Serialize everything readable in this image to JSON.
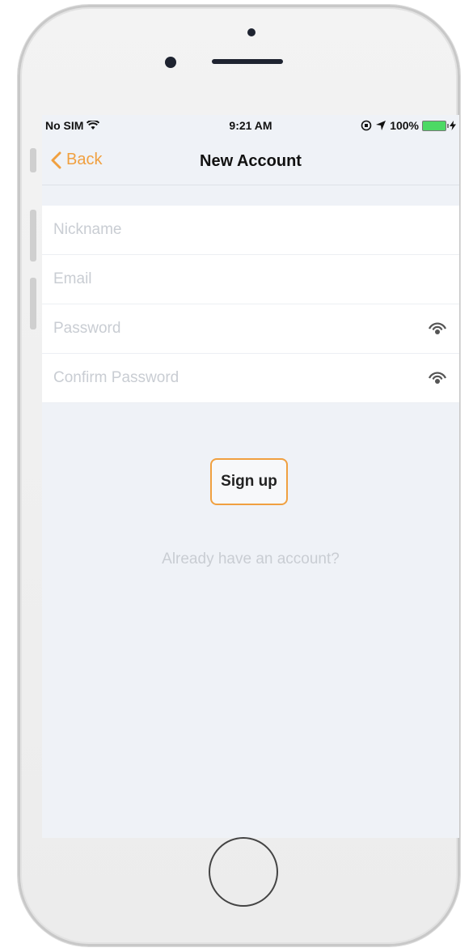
{
  "status_bar": {
    "carrier": "No SIM",
    "time": "9:21 AM",
    "battery": "100%",
    "wifi_icon": "wifi-icon",
    "location_icon": "location-arrow-icon",
    "lock_icon": "orientation-lock-icon"
  },
  "nav": {
    "back_label": "Back",
    "title": "New Account"
  },
  "form": {
    "nickname_placeholder": "Nickname",
    "nickname_value": "",
    "email_placeholder": "Email",
    "email_value": "",
    "password_placeholder": "Password",
    "password_value": "",
    "confirm_placeholder": "Confirm Password",
    "confirm_value": ""
  },
  "actions": {
    "signup_label": "Sign up",
    "already_label": "Already have an account?"
  },
  "colors": {
    "accent": "#f0a040",
    "background": "#eff2f7",
    "placeholder": "#c9cdd3",
    "battery": "#4cd964"
  }
}
